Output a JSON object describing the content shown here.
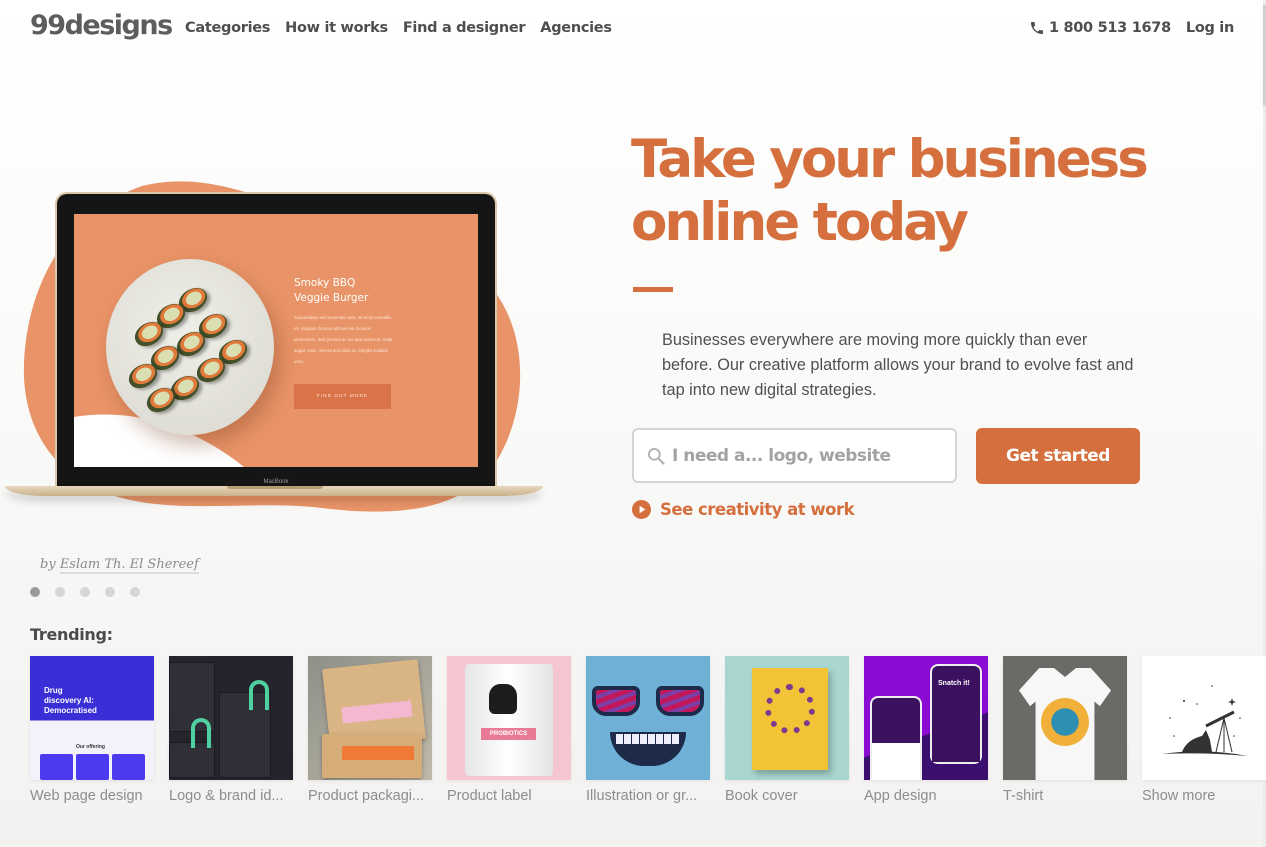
{
  "header": {
    "logo": "99designs",
    "nav": [
      {
        "label": "Categories"
      },
      {
        "label": "How it works"
      },
      {
        "label": "Find a designer"
      },
      {
        "label": "Agencies"
      }
    ],
    "phone": "1 800 513 1678",
    "login": "Log in"
  },
  "hero": {
    "headline_line1": "Take your business",
    "headline_line2": "online today",
    "intro": "Businesses everywhere are moving more quickly than ever before. Our creative platform allows your brand to evolve fast and tap into new digital strategies.",
    "search_placeholder": "I need a... logo, website",
    "search_value": "",
    "cta": "Get started",
    "see_link": "See creativity at work",
    "accent_color": "#d5703e",
    "showcase": {
      "screen_title_line1": "Smoky BBQ",
      "screen_title_line2": "Veggie Burger",
      "screen_body": "Suspendisse sed venenatis ante, sit amet convallis mi. Aliquam rhoncus ultrices leo rhoncus elementum. Sed pretium ac leo quis euismod. Nulla augue nunc, viverra quis nibh ac, fringilla sodales urna.",
      "screen_button": "FIND OUT MORE",
      "device_label": "MacBook"
    },
    "credit_prefix": "by",
    "credit_name": "Eslam Th. El Shereef",
    "carousel": {
      "total": 5,
      "active": 1
    }
  },
  "trending": {
    "label": "Trending:",
    "items": [
      {
        "label": "Web page design",
        "thumb": "web-page-design-thumbnail"
      },
      {
        "label": "Logo & brand id...",
        "thumb": "logo-brand-identity-thumbnail"
      },
      {
        "label": "Product packagi...",
        "thumb": "product-packaging-thumbnail"
      },
      {
        "label": "Product label",
        "thumb": "product-label-thumbnail"
      },
      {
        "label": "Illustration or gr...",
        "thumb": "illustration-thumbnail"
      },
      {
        "label": "Book cover",
        "thumb": "book-cover-thumbnail"
      },
      {
        "label": "App design",
        "thumb": "app-design-thumbnail"
      },
      {
        "label": "T-shirt",
        "thumb": "t-shirt-thumbnail"
      },
      {
        "label": "Show more",
        "thumb": "show-more-thumbnail"
      }
    ],
    "thumb_text": {
      "web": "Drug discovery AI: Democratised",
      "web_offering": "Our offering",
      "label_tag": "PROBIOTICS",
      "app_title": "Snatch it!"
    }
  }
}
